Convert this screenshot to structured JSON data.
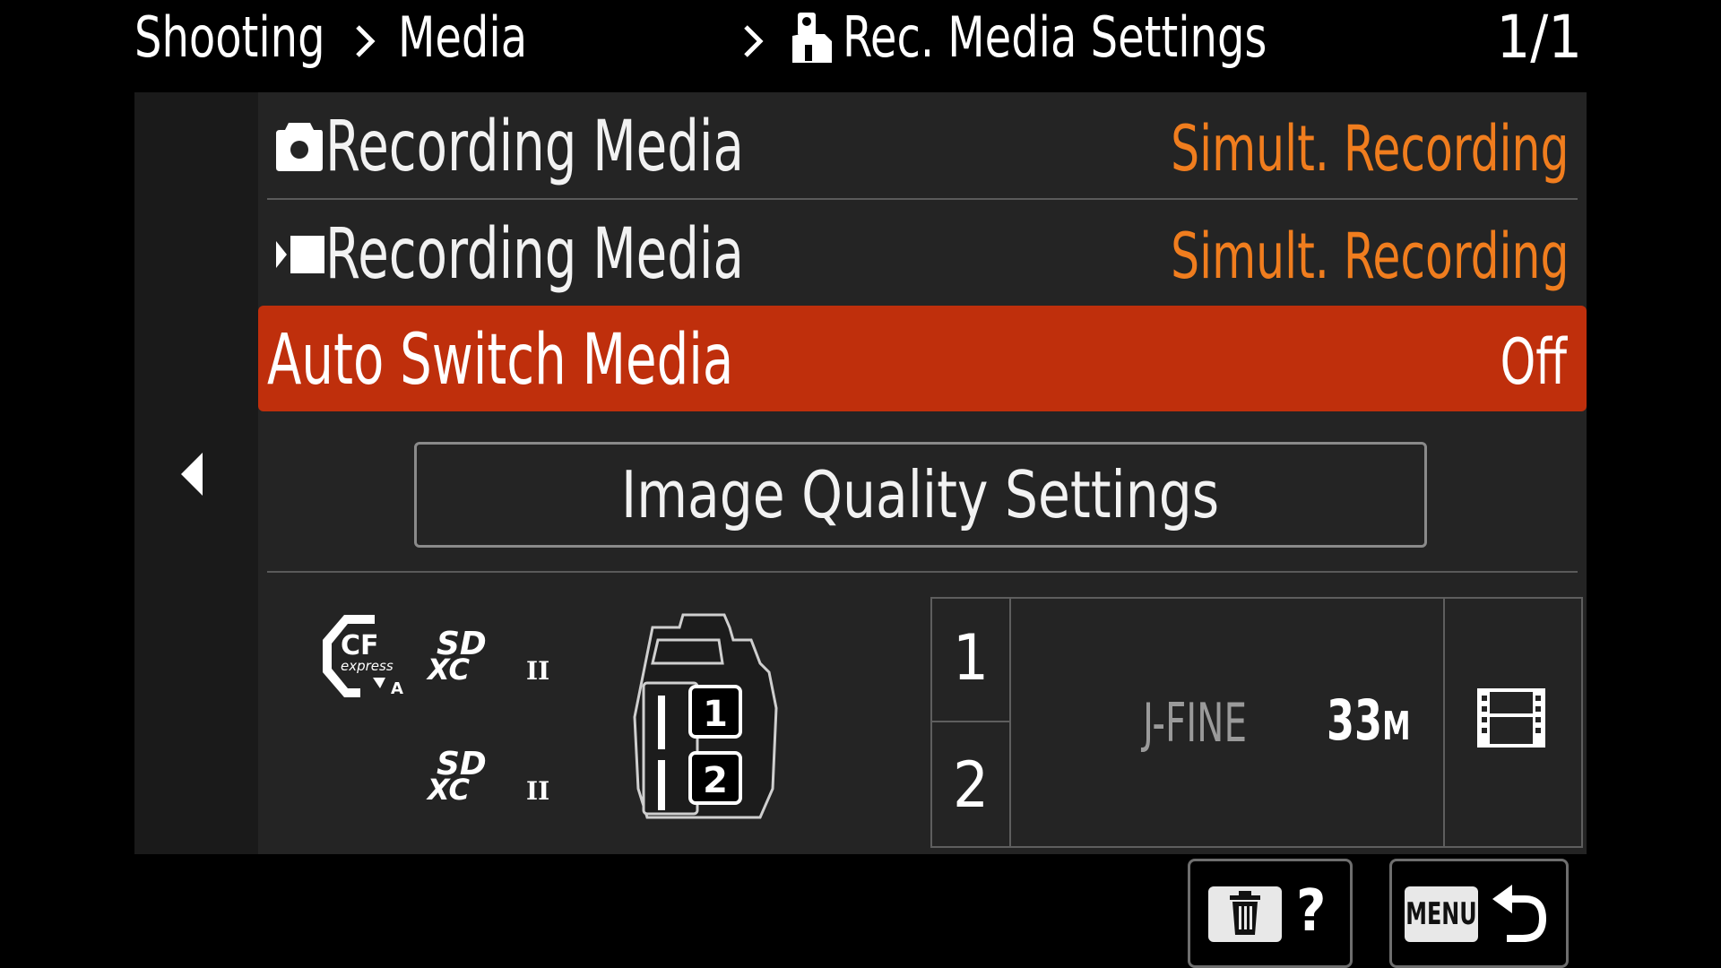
{
  "header": {
    "crumb_shooting": "Shooting",
    "crumb_media": "Media",
    "crumb_page": "Rec. Media Settings",
    "page_indicator": "1/1"
  },
  "menu": {
    "items": [
      {
        "icon": "camera-still-icon",
        "label": "Recording Media",
        "value": "Simult. Recording",
        "selected": false
      },
      {
        "icon": "movie-camera-icon",
        "label": "Recording Media",
        "value": "Simult. Recording",
        "selected": false
      },
      {
        "icon": "",
        "label": "Auto Switch Media",
        "value": "Off",
        "selected": true
      }
    ],
    "image_quality_button": "Image Quality Settings"
  },
  "media_info": {
    "card_logos": [
      "cfexpress-type-a-logo",
      "sdxc-uhs-ii-logo",
      "sdxc-uhs-ii-logo"
    ],
    "slots": [
      "1",
      "2"
    ],
    "quality": "J-FINE",
    "image_size_value": "33",
    "image_size_unit": "M",
    "movie_icon": "film-strip-icon"
  },
  "footer": {
    "delete_help_icons": [
      "trash-icon",
      "help-icon"
    ],
    "help_label": "?",
    "menu_label": "MENU",
    "back_icon": "return-arrow-icon"
  },
  "colors": {
    "accent_selected": "#bf2f0c",
    "value_orange": "#f07d1e",
    "panel": "#242424",
    "background": "#000000"
  }
}
